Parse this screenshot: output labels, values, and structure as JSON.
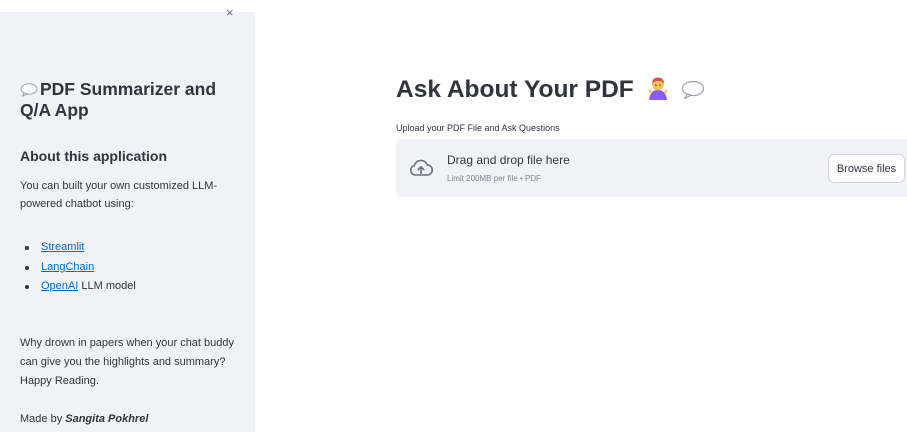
{
  "sidebar": {
    "close_glyph": "×",
    "title": "PDF Summarizer and Q/A App",
    "about_heading": "About this application",
    "about_text": "You can built your own customized LLM-powered chatbot using:",
    "tools": [
      {
        "link": "Streamlit",
        "suffix": ""
      },
      {
        "link": "LangChain",
        "suffix": ""
      },
      {
        "link": "OpenAI",
        "suffix": " LLM model"
      }
    ],
    "tagline": "Why drown in papers when your chat buddy can give you the highlights and summary? Happy Reading.",
    "made_by_prefix": "Made by ",
    "made_by_name": "Sangita Pokhrel"
  },
  "main": {
    "title": "Ask About Your PDF",
    "title_icons": [
      "person-shrugging-emoji",
      "speech-bubble-icon"
    ],
    "upload_label": "Upload your PDF File and Ask Questions",
    "dropzone": {
      "title": "Drag and drop file here",
      "subtitle": "Limit 200MB per file • PDF",
      "button": "Browse files",
      "icon": "cloud-upload-icon"
    }
  },
  "colors": {
    "sidebar_bg": "#f0f2f6",
    "text": "#31333f",
    "link": "#0068c9",
    "dropzone_bg": "#f0f2f6",
    "muted": "#808495"
  }
}
